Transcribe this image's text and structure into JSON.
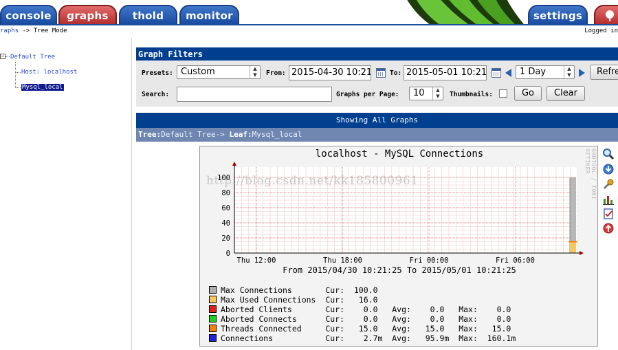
{
  "tabs": {
    "console": "console",
    "graphs": "graphs",
    "thold": "thold",
    "monitor": "monitor",
    "settings": "settings"
  },
  "breadcrumb": {
    "graphs_link": "raphs",
    "sep": " -> ",
    "current": "Tree Mode"
  },
  "logged_in": "Logged in",
  "tree": {
    "root": "Default Tree",
    "host": "Host: localhost",
    "leaf": "Mysql_local"
  },
  "filters": {
    "header": "Graph Filters",
    "presets_label": "Presets:",
    "presets_value": "Custom",
    "from_label": "From:",
    "from_value": "2015-04-30 10:21",
    "to_label": "To:",
    "to_value": "2015-05-01 10:21",
    "span_value": "1 Day",
    "refresh_label": "Refre",
    "search_label": "Search:",
    "search_value": "",
    "gpp_label": "Graphs per Page:",
    "gpp_value": "10",
    "thumbs_label": "Thumbnails:",
    "go_label": "Go",
    "clear_label": "Clear"
  },
  "showing": "Showing All Graphs",
  "treeinfo": {
    "tree_label": "Tree:",
    "tree_value": "Default Tree->",
    "leaf_label": "Leaf:",
    "leaf_value": "Mysql_local"
  },
  "graph": {
    "title": "localhost - MySQL Connections",
    "vertical_text": "RRDTOOL / TOBI OETIKER",
    "subtitle": "From 2015/04/30 10:21:25 To 2015/05/01 10:21:25",
    "y_ticks": [
      "0",
      "20",
      "40",
      "60",
      "80",
      "100"
    ],
    "x_ticks": [
      "Thu 12:00",
      "Thu 18:00",
      "Fri 00:00",
      "Fri 06:00"
    ],
    "legend": [
      {
        "name": "Max Connections",
        "text": "Cur:  100.0",
        "color": "#b0b0b0"
      },
      {
        "name": "Max Used Connections",
        "text": "Cur:   16.0",
        "color": "#f8c860"
      },
      {
        "name": "Aborted Clients",
        "text": "Cur:    0.0   Avg:    0.0   Max:    0.0",
        "color": "#e02020"
      },
      {
        "name": "Aborted Connects",
        "text": "Cur:    0.0   Avg:    0.0   Max:    0.0",
        "color": "#22cc22"
      },
      {
        "name": "Threads Connected",
        "text": "Cur:   15.0   Avg:   15.0   Max:   15.0",
        "color": "#f08010"
      },
      {
        "name": "Connections",
        "text": "Cur:    2.7m  Avg:   95.9m  Max:  160.1m",
        "color": "#2222dd"
      }
    ]
  },
  "chart_data": {
    "type": "area",
    "title": "localhost - MySQL Connections",
    "x": [
      "Thu 12:00",
      "Thu 18:00",
      "Fri 00:00",
      "Fri 06:00"
    ],
    "ylim": [
      0,
      100
    ],
    "grid": true,
    "series": [
      {
        "name": "Max Connections",
        "values": [
          0,
          0,
          0,
          100
        ]
      },
      {
        "name": "Max Used Connections",
        "values": [
          0,
          0,
          0,
          16
        ]
      },
      {
        "name": "Threads Connected",
        "values": [
          0,
          0,
          0,
          15
        ]
      }
    ]
  },
  "watermark": "http://blog.csdn.net/kk185800961",
  "icons": [
    "zoom-icon",
    "download-icon",
    "wrench-icon",
    "bar-chart-icon",
    "properties-icon",
    "up-arrow-icon"
  ]
}
